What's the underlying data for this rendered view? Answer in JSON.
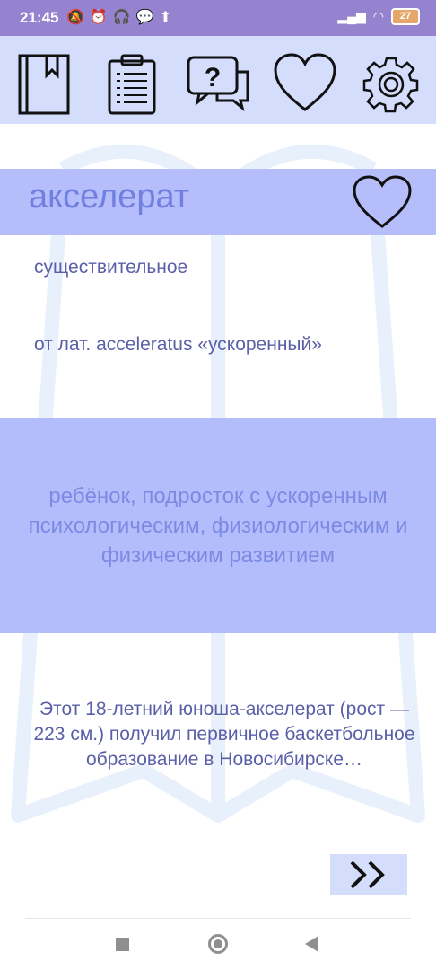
{
  "status_bar": {
    "time": "21:45",
    "icons_left": [
      "mute-icon",
      "alarm-icon",
      "headphones-icon",
      "chat-icon",
      "upload-icon"
    ],
    "battery": "27"
  },
  "toolbar": {
    "items": [
      {
        "name": "dictionary-book-icon"
      },
      {
        "name": "clipboard-list-icon"
      },
      {
        "name": "question-chat-icon"
      },
      {
        "name": "favorites-heart-icon"
      },
      {
        "name": "settings-gear-icon"
      }
    ]
  },
  "word": {
    "title": "акселерат",
    "part_of_speech": "существительное",
    "etymology": "от лат. acceleratus «ускоренный»",
    "definition": "ребёнок, подросток с ускоренным психологическим, физиологическим и физическим развитием",
    "example": "Этот 18-летний юноша-акселерат (рост — 223 см.) получил первичное баскетбольное образование в Новосибирске…"
  },
  "colors": {
    "status_bar": "#9583cf",
    "toolbar": "#d4ddfb",
    "word_bar": "#b5bdfa",
    "definition_bg": "#b3bdfb",
    "title_text": "#6f80e0",
    "body_text": "#5a5fa8"
  }
}
